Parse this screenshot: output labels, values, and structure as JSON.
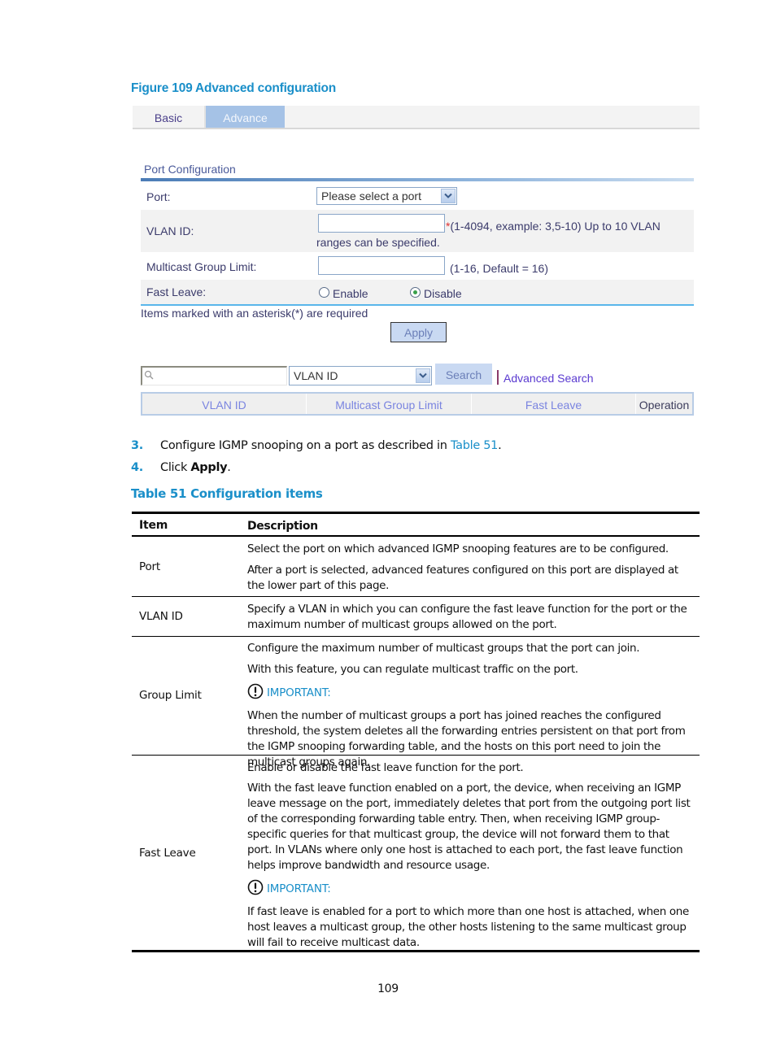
{
  "figure": {
    "title": "Figure 109 Advanced configuration"
  },
  "ui": {
    "tabs": [
      {
        "label": "Basic",
        "active": false
      },
      {
        "label": "Advance",
        "active": true
      }
    ],
    "section_title": "Port Configuration",
    "form": {
      "port": {
        "label": "Port:",
        "selected": "Please select a port"
      },
      "vlan_id": {
        "label": "VLAN ID:",
        "value": "",
        "required_mark": "*",
        "hint_line1": "(1-4094, example: 3,5-10) Up to 10 VLAN",
        "hint_line2": "ranges can be specified."
      },
      "group_limit": {
        "label": "Multicast Group Limit:",
        "value": "",
        "hint": "(1-16, Default = 16)"
      },
      "fast_leave": {
        "label": "Fast Leave:",
        "options": [
          {
            "label": "Enable",
            "checked": false
          },
          {
            "label": "Disable",
            "checked": true
          }
        ]
      }
    },
    "required_note": "Items marked with an asterisk(*) are required",
    "apply_label": "Apply",
    "search": {
      "input_value": "",
      "field_selected": "VLAN ID",
      "search_label": "Search",
      "advanced_label": "Advanced Search"
    },
    "table_headers": [
      "VLAN ID",
      "Multicast Group Limit",
      "Fast Leave",
      "Operation"
    ]
  },
  "steps": [
    {
      "num": "3.",
      "text_before": "Configure IGMP snooping on a port as described in ",
      "link": "Table 51",
      "text_after": "."
    },
    {
      "num": "4.",
      "text_before": "Click ",
      "bold": "Apply",
      "text_after": "."
    }
  ],
  "table": {
    "title": "Table 51 Configuration items",
    "headers": [
      "Item",
      "Description"
    ],
    "important_label": "IMPORTANT:",
    "rows": [
      {
        "item": "Port",
        "paragraphs": [
          "Select the port on which advanced IGMP snooping features are to be configured.",
          "After a port is selected, advanced features configured on this port are displayed at the lower part of this page."
        ]
      },
      {
        "item": "VLAN ID",
        "paragraphs": [
          "Specify a VLAN in which you can configure the fast leave function for the port or the maximum number of multicast groups allowed on the port."
        ]
      },
      {
        "item": "Group Limit",
        "paragraphs": [
          "Configure the maximum number of multicast groups that the port can join.",
          "With this feature, you can regulate multicast traffic on the port."
        ],
        "important": "When the number of multicast groups a port has joined reaches the configured threshold, the system deletes all the forwarding entries persistent on that port from the IGMP snooping forwarding table, and the hosts on this port need to join the multicast groups again."
      },
      {
        "item": "Fast Leave",
        "paragraphs": [
          "Enable or disable the fast leave function for the port.",
          "With the fast leave function enabled on a port, the device, when receiving an IGMP leave message on the port, immediately deletes that port from the outgoing port list of the corresponding forwarding table entry. Then, when receiving IGMP group-specific queries for that multicast group, the device will not forward them to that port. In VLANs where only one host is attached to each port, the fast leave function helps improve bandwidth and resource usage."
        ],
        "important": "If fast leave is enabled for a port to which more than one host is attached, when one host leaves a multicast group, the other hosts listening to the same multicast group will fail to receive multicast data."
      }
    ]
  },
  "page_number": "109"
}
